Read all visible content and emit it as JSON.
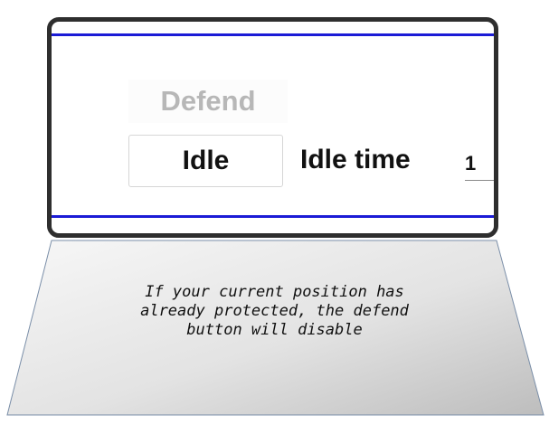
{
  "panel": {
    "defend_label": "Defend",
    "defend_state": "disabled",
    "idle_label": "Idle",
    "idle_time_label": "Idle time",
    "idle_time_value": "1",
    "accent_line_color": "#1b1bd6"
  },
  "tooltip": {
    "lines": [
      "If your current position has",
      "already protected, the defend",
      "button will disable"
    ]
  }
}
